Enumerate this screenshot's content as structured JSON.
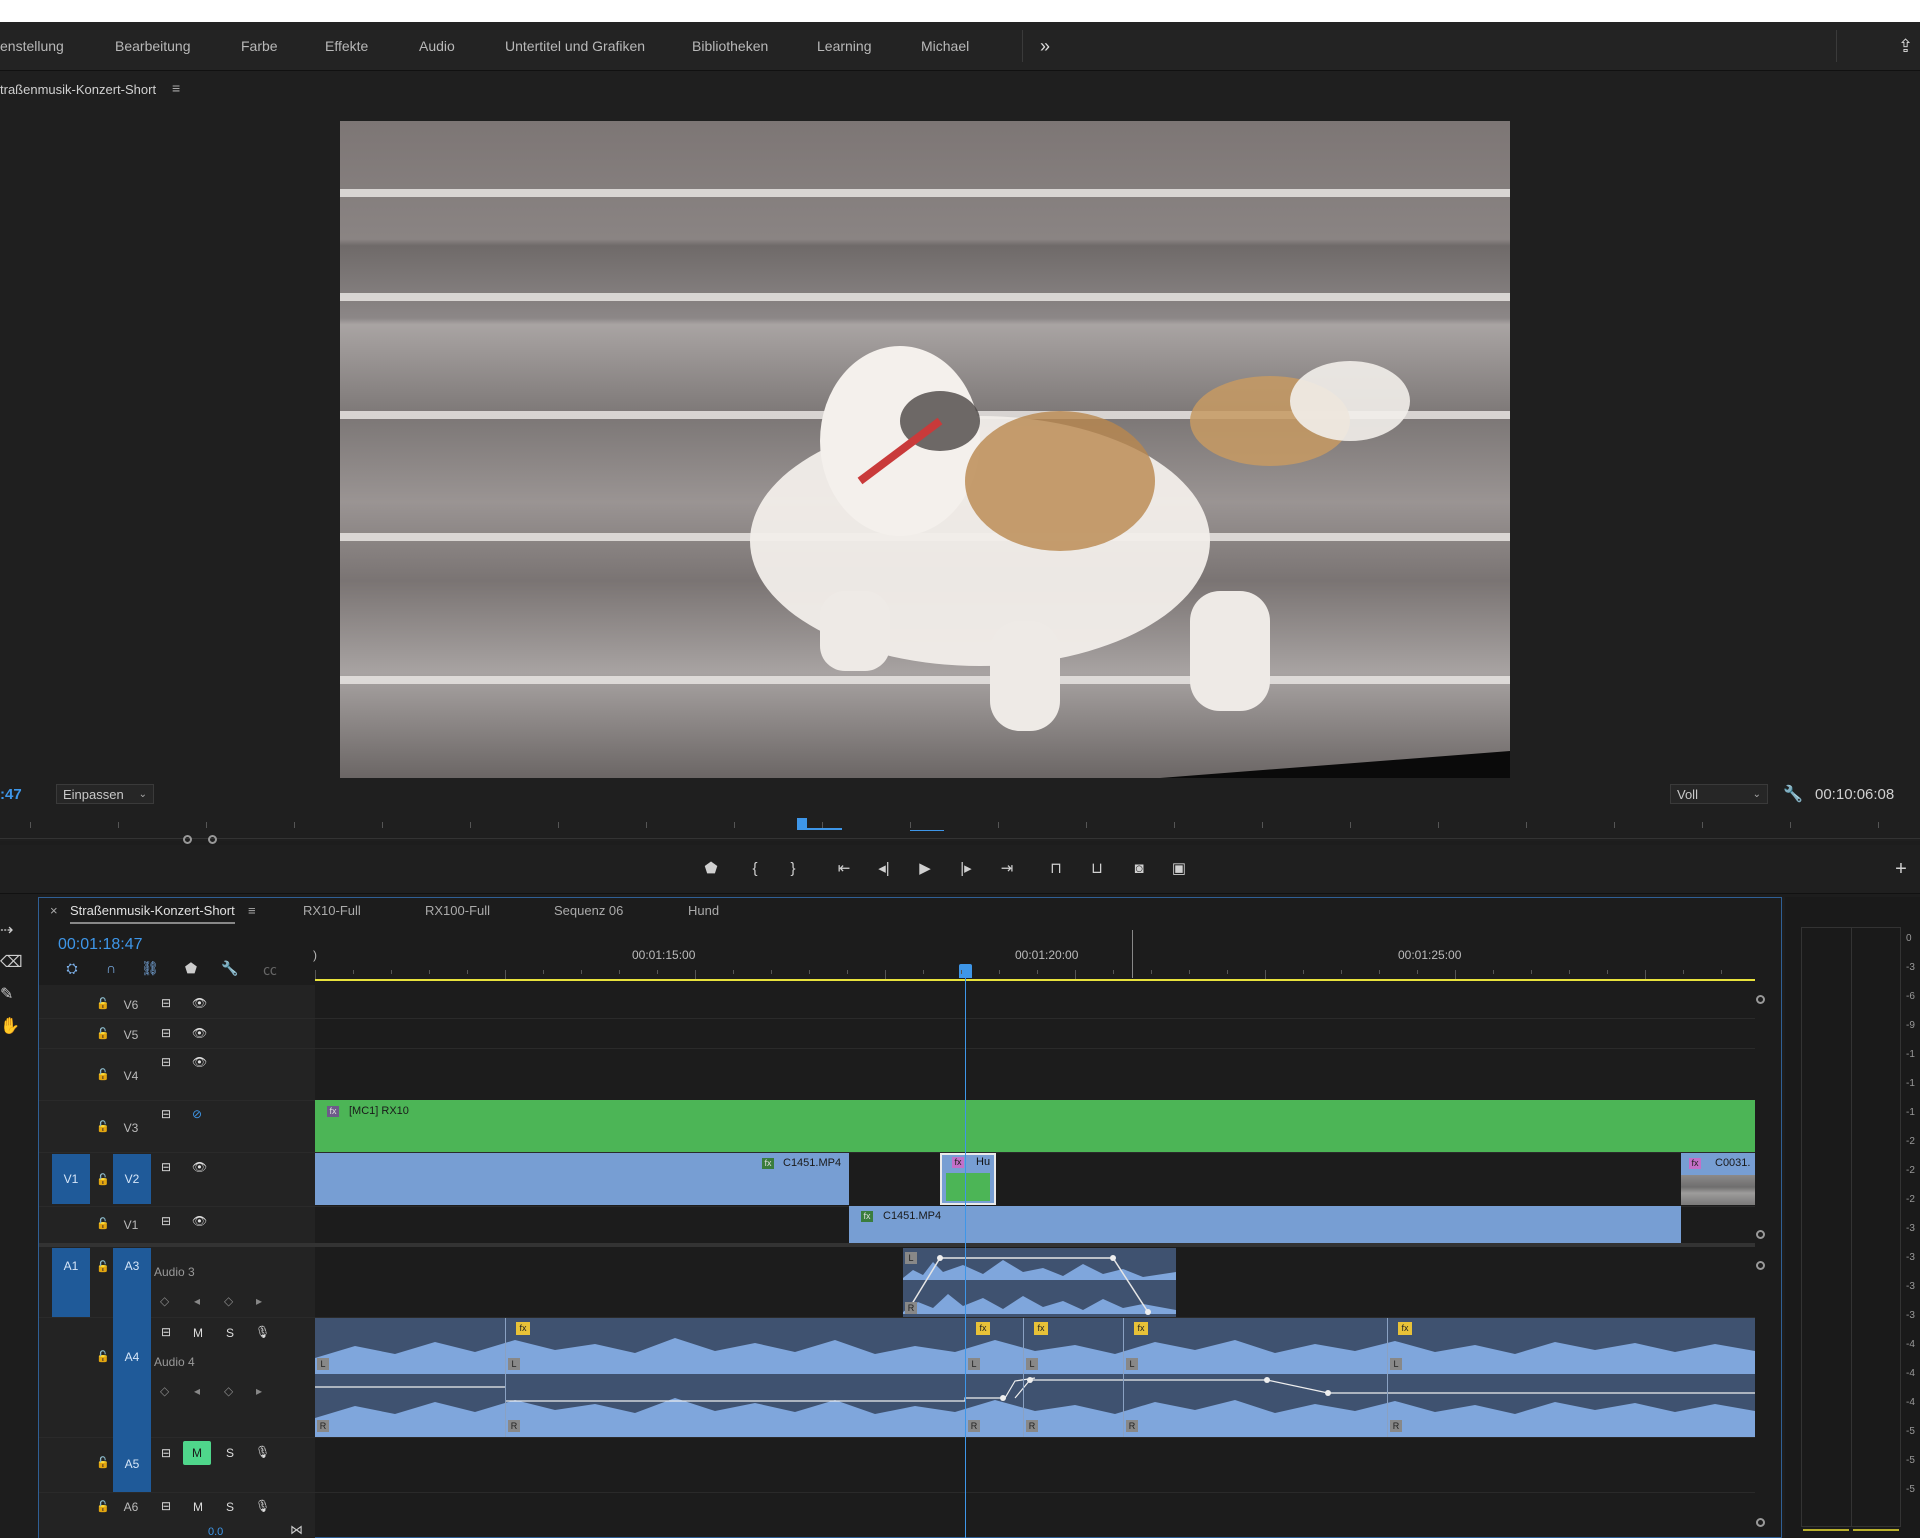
{
  "nav": {
    "items": [
      "enstellung",
      "Bearbeitung",
      "Farbe",
      "Effekte",
      "Audio",
      "Untertitel und Grafiken",
      "Bibliotheken",
      "Learning",
      "Michael"
    ],
    "overflow": "»",
    "share_icon": "share-icon"
  },
  "monitor": {
    "title": "traßenmusik-Konzert-Short",
    "menu": "≡",
    "timecode_left": ":47",
    "fit_dropdown": "Einpassen",
    "quality_dropdown": "Voll",
    "timecode_right": "00:10:06:08"
  },
  "transport": {
    "buttons": [
      "marker-icon",
      "mark-in-icon",
      "mark-out-icon",
      "go-to-in-icon",
      "step-back-icon",
      "play-icon",
      "step-forward-icon",
      "go-to-out-icon",
      "lift-icon",
      "extract-icon",
      "export-frame-icon",
      "comparison-view-icon",
      "add-button-icon"
    ]
  },
  "timeline": {
    "tabs": [
      "Straßenmusik-Konzert-Short",
      "RX10-Full",
      "RX100-Full",
      "Sequenz 06",
      "Hund"
    ],
    "tab_close": "×",
    "tab_menu": "≡",
    "timecode": "00:01:18:47",
    "ruler_labels": [
      "00:01:15:00",
      "00:01:20:00",
      "00:01:25:00"
    ],
    "ruler_edge_label": ")",
    "video_tracks": [
      "V6",
      "V5",
      "V4",
      "V3",
      "V2",
      "V1"
    ],
    "audio_tracks": [
      "A3",
      "A4",
      "A5",
      "A6"
    ],
    "source_patches": {
      "video": "V1",
      "audio": "A1"
    },
    "track_names": {
      "A3": "Audio 3",
      "A4": "Audio 4"
    },
    "audio_buttons": {
      "mute": "M",
      "solo": "S"
    },
    "volume_readout": "0.0",
    "clips": {
      "v3": "[MC1] RX10",
      "v2_a": "C1451.MP4",
      "v2_b": "Hu",
      "v2_c": "C0031.",
      "v1": "C1451.MP4"
    },
    "fx_label": "fx",
    "channel_labels": {
      "left": "L",
      "right": "R"
    }
  },
  "meter": {
    "labels": [
      "0",
      "-3",
      "-6",
      "-9",
      "-1",
      "-1",
      "-1",
      "-2",
      "-2",
      "-2",
      "-3",
      "-3",
      "-3",
      "-3",
      "-4",
      "-4",
      "-4",
      "-5",
      "-5",
      "-5"
    ]
  },
  "colors": {
    "accent": "#3e96e8",
    "clip_green": "#4cb556",
    "clip_blue": "#779ed3",
    "audio_clip": "#3f5270",
    "work_area": "#e8e23c",
    "patch": "#1f5a99"
  }
}
